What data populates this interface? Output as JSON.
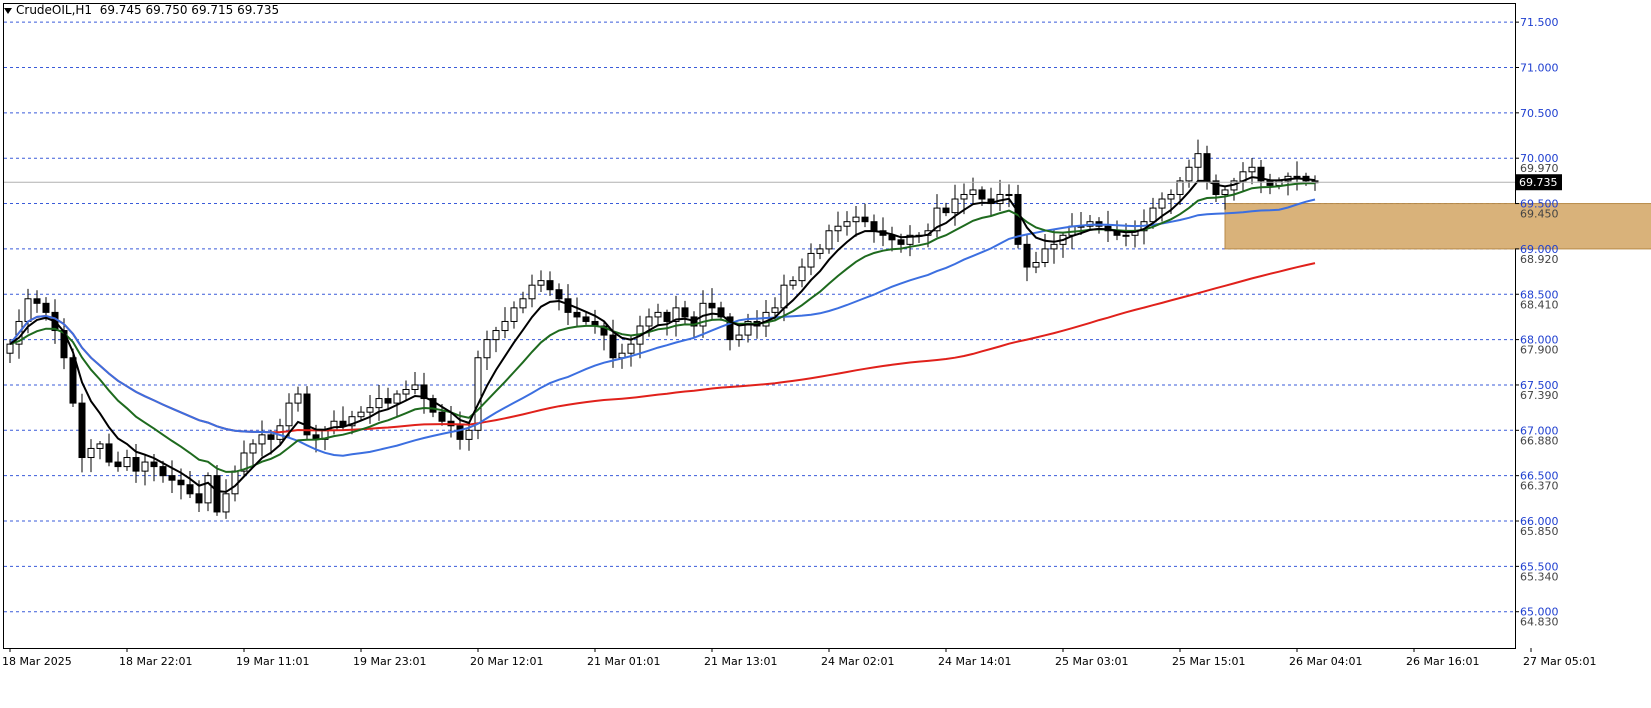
{
  "header": {
    "symbol": "CrudeOIL,H1",
    "ohlc": "69.745 69.750 69.715 69.735"
  },
  "colors": {
    "grid_line": "#3a5bd9",
    "axis_label": "#1f3fd0",
    "sma_red": "#e0211b",
    "sma_blue": "#3c6fe0",
    "ema_green": "#1e6a1e",
    "ema_black": "#000000",
    "zone_fill": "#d9b27a",
    "bull": "#ffffff",
    "bear": "#000000"
  },
  "chart_data": {
    "type": "candlestick",
    "symbol": "CrudeOIL",
    "timeframe": "H1",
    "current_price": 69.735,
    "current_price_label": "69.735",
    "ylim": [
      64.6,
      71.7
    ],
    "grid_levels": [
      {
        "value": 71.5,
        "label": "71.500",
        "sub": ""
      },
      {
        "value": 71.0,
        "label": "71.000",
        "sub": ""
      },
      {
        "value": 70.5,
        "label": "70.500",
        "sub": ""
      },
      {
        "value": 70.0,
        "label": "70.000",
        "sub": "69.970"
      },
      {
        "value": 69.5,
        "label": "69.500",
        "sub": "69.450"
      },
      {
        "value": 69.0,
        "label": "69.000",
        "sub": "68.920"
      },
      {
        "value": 68.5,
        "label": "68.500",
        "sub": "68.410"
      },
      {
        "value": 68.0,
        "label": "68.000",
        "sub": "67.900"
      },
      {
        "value": 67.5,
        "label": "67.500",
        "sub": "67.390"
      },
      {
        "value": 67.0,
        "label": "67.000",
        "sub": "66.880"
      },
      {
        "value": 66.5,
        "label": "66.500",
        "sub": "66.370"
      },
      {
        "value": 66.0,
        "label": "66.000",
        "sub": "65.850"
      },
      {
        "value": 65.5,
        "label": "65.500",
        "sub": "65.340"
      },
      {
        "value": 65.0,
        "label": "65.000",
        "sub": "64.830"
      }
    ],
    "x_labels": [
      {
        "label": "18 Mar 2025",
        "bar": 0
      },
      {
        "label": "18 Mar 22:01",
        "bar": 13
      },
      {
        "label": "19 Mar 11:01",
        "bar": 26
      },
      {
        "label": "19 Mar 23:01",
        "bar": 39
      },
      {
        "label": "20 Mar 12:01",
        "bar": 52
      },
      {
        "label": "21 Mar 01:01",
        "bar": 65
      },
      {
        "label": "21 Mar 13:01",
        "bar": 78
      },
      {
        "label": "24 Mar 02:01",
        "bar": 91
      },
      {
        "label": "24 Mar 14:01",
        "bar": 104
      },
      {
        "label": "25 Mar 03:01",
        "bar": 117
      },
      {
        "label": "25 Mar 15:01",
        "bar": 130
      },
      {
        "label": "26 Mar 04:01",
        "bar": 143
      },
      {
        "label": "26 Mar 16:01",
        "bar": 156
      },
      {
        "label": "27 Mar 05:01",
        "bar": 169
      }
    ],
    "zone": {
      "bar_start": 135,
      "bar_end": 186,
      "low": 69.0,
      "high": 69.5
    },
    "closes": [
      67.95,
      68.2,
      68.45,
      68.4,
      68.3,
      68.1,
      67.8,
      67.3,
      66.7,
      66.8,
      66.85,
      66.65,
      66.6,
      66.7,
      66.55,
      66.65,
      66.6,
      66.5,
      66.45,
      66.4,
      66.3,
      66.2,
      66.5,
      66.1,
      66.3,
      66.55,
      66.75,
      66.85,
      66.95,
      66.9,
      67.05,
      67.3,
      67.4,
      66.95,
      66.9,
      67.0,
      67.1,
      67.05,
      67.15,
      67.2,
      67.25,
      67.35,
      67.3,
      67.4,
      67.45,
      67.5,
      67.35,
      67.2,
      67.1,
      67.05,
      66.9,
      67.0,
      67.8,
      68.0,
      68.1,
      68.2,
      68.35,
      68.45,
      68.6,
      68.65,
      68.55,
      68.45,
      68.3,
      68.25,
      68.2,
      68.15,
      68.05,
      67.8,
      67.85,
      67.95,
      68.15,
      68.25,
      68.3,
      68.2,
      68.35,
      68.25,
      68.15,
      68.4,
      68.35,
      68.25,
      68.0,
      68.05,
      68.2,
      68.15,
      68.3,
      68.35,
      68.6,
      68.65,
      68.8,
      68.95,
      69.0,
      69.2,
      69.25,
      69.3,
      69.35,
      69.3,
      69.2,
      69.15,
      69.1,
      69.05,
      69.15,
      69.15,
      69.2,
      69.45,
      69.4,
      69.55,
      69.6,
      69.65,
      69.55,
      69.5,
      69.6,
      69.6,
      69.05,
      68.8,
      68.85,
      69.0,
      69.05,
      69.15,
      69.25,
      69.25,
      69.3,
      69.25,
      69.2,
      69.15,
      69.15,
      69.2,
      69.3,
      69.45,
      69.55,
      69.6,
      69.75,
      69.9,
      70.05,
      69.75,
      69.6,
      69.65,
      69.75,
      69.85,
      69.9,
      69.75,
      69.7,
      69.75,
      69.8,
      69.8,
      69.75,
      69.73
    ]
  }
}
